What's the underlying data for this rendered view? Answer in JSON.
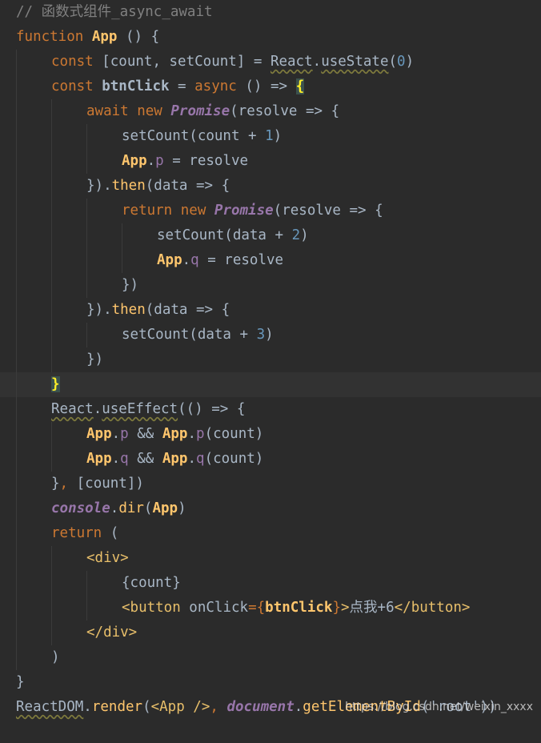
{
  "editor": {
    "background": "#2b2b2b",
    "lines": [
      {
        "comment": "// 函数式组件_async_await"
      },
      {
        "kw_function": "function",
        "name": "App",
        "rest": " () {"
      },
      {
        "kw_const": "const",
        "destructure": " [count, setCount] = ",
        "react": "React",
        "dot": ".",
        "hook": "useState",
        "open": "(",
        "num": "0",
        "close": ")"
      },
      {
        "kw_const": "const",
        "name": " btnClick",
        "eq": " = ",
        "kw_async": "async",
        "arrow": " () => ",
        "brace": "{"
      },
      {
        "kw_await": "await",
        "kw_new": " new",
        "cls": " Promise",
        "rest": "(resolve => {"
      },
      {
        "call": "setCount(count + ",
        "num": "1",
        "close": ")"
      },
      {
        "obj": "App",
        "dot": ".",
        "prop": "p",
        "rest": " = resolve"
      },
      {
        "close": "}).",
        "method": "then",
        "rest": "(data => {"
      },
      {
        "kw_return": "return",
        "kw_new": " new",
        "cls": " Promise",
        "rest": "(resolve => {"
      },
      {
        "call": "setCount(data + ",
        "num": "2",
        "close": ")"
      },
      {
        "obj": "App",
        "dot": ".",
        "prop": "q",
        "rest": " = resolve"
      },
      {
        "close": "})"
      },
      {
        "close": "}).",
        "method": "then",
        "rest": "(data => {"
      },
      {
        "call": "setCount(data + ",
        "num": "3",
        "close": ")"
      },
      {
        "close": "})"
      },
      {
        "brace": "}"
      },
      {
        "react": "React",
        "dot": ".",
        "hook": "useEffect",
        "rest": "(() => {"
      },
      {
        "obj1": "App",
        "dot1": ".",
        "prop1": "p",
        "amp": " && ",
        "obj2": "App",
        "dot2": ".",
        "prop2": "p",
        "rest": "(count)"
      },
      {
        "obj1": "App",
        "dot1": ".",
        "prop1": "q",
        "amp": " && ",
        "obj2": "App",
        "dot2": ".",
        "prop2": "q",
        "rest": "(count)"
      },
      {
        "close": "}",
        "comma": ",",
        "rest": " [count])"
      },
      {
        "global": "console",
        "dot": ".",
        "method": "dir",
        "open": "(",
        "arg": "App",
        "close": ")"
      },
      {
        "kw_return": "return",
        "rest": " ("
      },
      {
        "tag": "<div>"
      },
      {
        "expr": "{count}"
      },
      {
        "tag_open": "<button",
        "attr": " onClick",
        "eq": "=",
        "ob": "{",
        "handler": "btnClick",
        "cb": "}",
        "gt": ">",
        "text": "点我+6",
        "tag_close": "</button>"
      },
      {
        "tag": "</div>"
      },
      {
        "close": ")"
      },
      {
        "close": "}"
      },
      {
        "react_dom": "ReactDOM",
        "dot": ".",
        "method": "render",
        "open": "(",
        "tag": "<App />",
        "comma": ", ",
        "global": "document",
        "dot2": ".",
        "method2": "getElementById",
        "rest": "('root'))"
      }
    ]
  },
  "watermark": "https://blog.csdn.net/weixin_xxxx"
}
